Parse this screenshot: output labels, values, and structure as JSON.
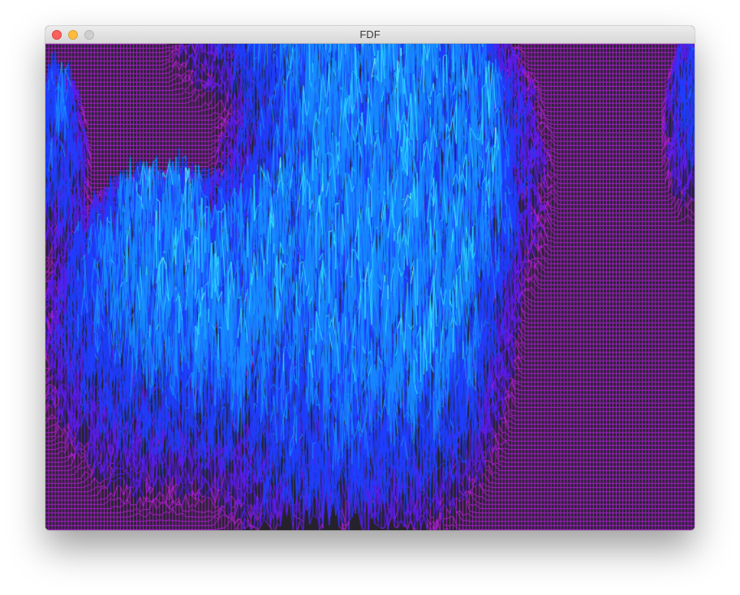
{
  "window": {
    "title": "FDF"
  },
  "titlebar": {
    "buttons": [
      {
        "name": "close",
        "color": "#fc605c"
      },
      {
        "name": "minimize",
        "color": "#fdbc40"
      },
      {
        "name": "zoom",
        "color": "#cfcfcf"
      }
    ]
  },
  "render": {
    "type": "wireframe-heightmap",
    "background_color": "#25222c",
    "palette": {
      "low": "#b11ed6",
      "mid_low": "#5a1cf0",
      "mid": "#1d3fff",
      "mid_high": "#168cff",
      "high": "#2fdfff",
      "peak": "#7affe8"
    }
  }
}
